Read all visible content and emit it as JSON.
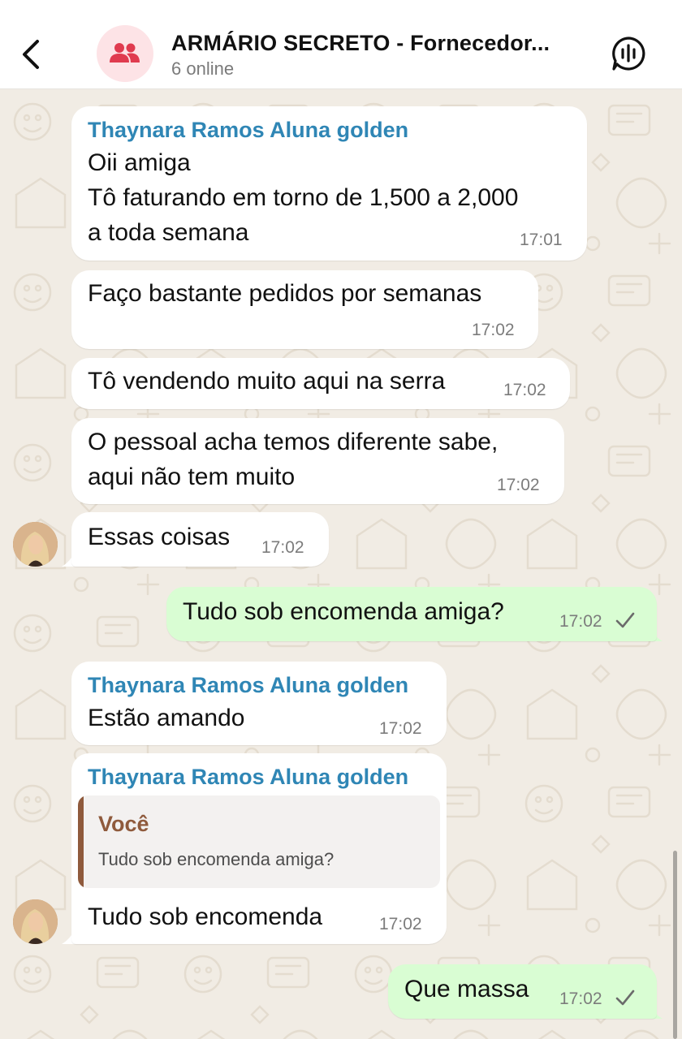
{
  "header": {
    "title": "ARMÁRIO SECRETO - Fornecedor...",
    "subtitle": "6 online",
    "icons": {
      "back": "chevron-left-icon",
      "group": "group-icon",
      "voice": "voice-chat-icon"
    },
    "avatar_bg": "#fde3e6",
    "avatar_fg": "#e03b4f"
  },
  "colors": {
    "incoming": "#ffffff",
    "outgoing": "#d9fdd3",
    "sender_name": "#2f86b5",
    "quote_accent": "#8f5a3c",
    "wallpaper": "#f1ece4"
  },
  "messages": [
    {
      "sender": "Thaynara Ramos Aluna golden",
      "lines": [
        "Oii amiga",
        "Tô faturando em torno de 1,500 a 2,000",
        "a toda semana"
      ],
      "time": "17:01"
    },
    {
      "lines": [
        "Faço bastante pedidos por semanas"
      ],
      "time": "17:02"
    },
    {
      "lines": [
        "Tô vendendo muito aqui na serra"
      ],
      "time": "17:02"
    },
    {
      "lines": [
        "O pessoal acha temos diferente sabe,",
        "aqui não tem muito"
      ],
      "time": "17:02"
    },
    {
      "lines": [
        "Essas coisas"
      ],
      "time": "17:02"
    },
    {
      "lines": [
        "Tudo sob encomenda amiga?"
      ],
      "time": "17:02",
      "outgoing": true
    },
    {
      "sender": "Thaynara Ramos Aluna golden",
      "lines": [
        "Estão amando"
      ],
      "time": "17:02"
    },
    {
      "sender": "Thaynara Ramos Aluna golden",
      "quote": {
        "name": "Você",
        "text": "Tudo sob encomenda amiga?"
      },
      "lines": [
        "Tudo sob encomenda"
      ],
      "time": "17:02"
    },
    {
      "lines": [
        "Que massa"
      ],
      "time": "17:02",
      "outgoing": true
    }
  ]
}
